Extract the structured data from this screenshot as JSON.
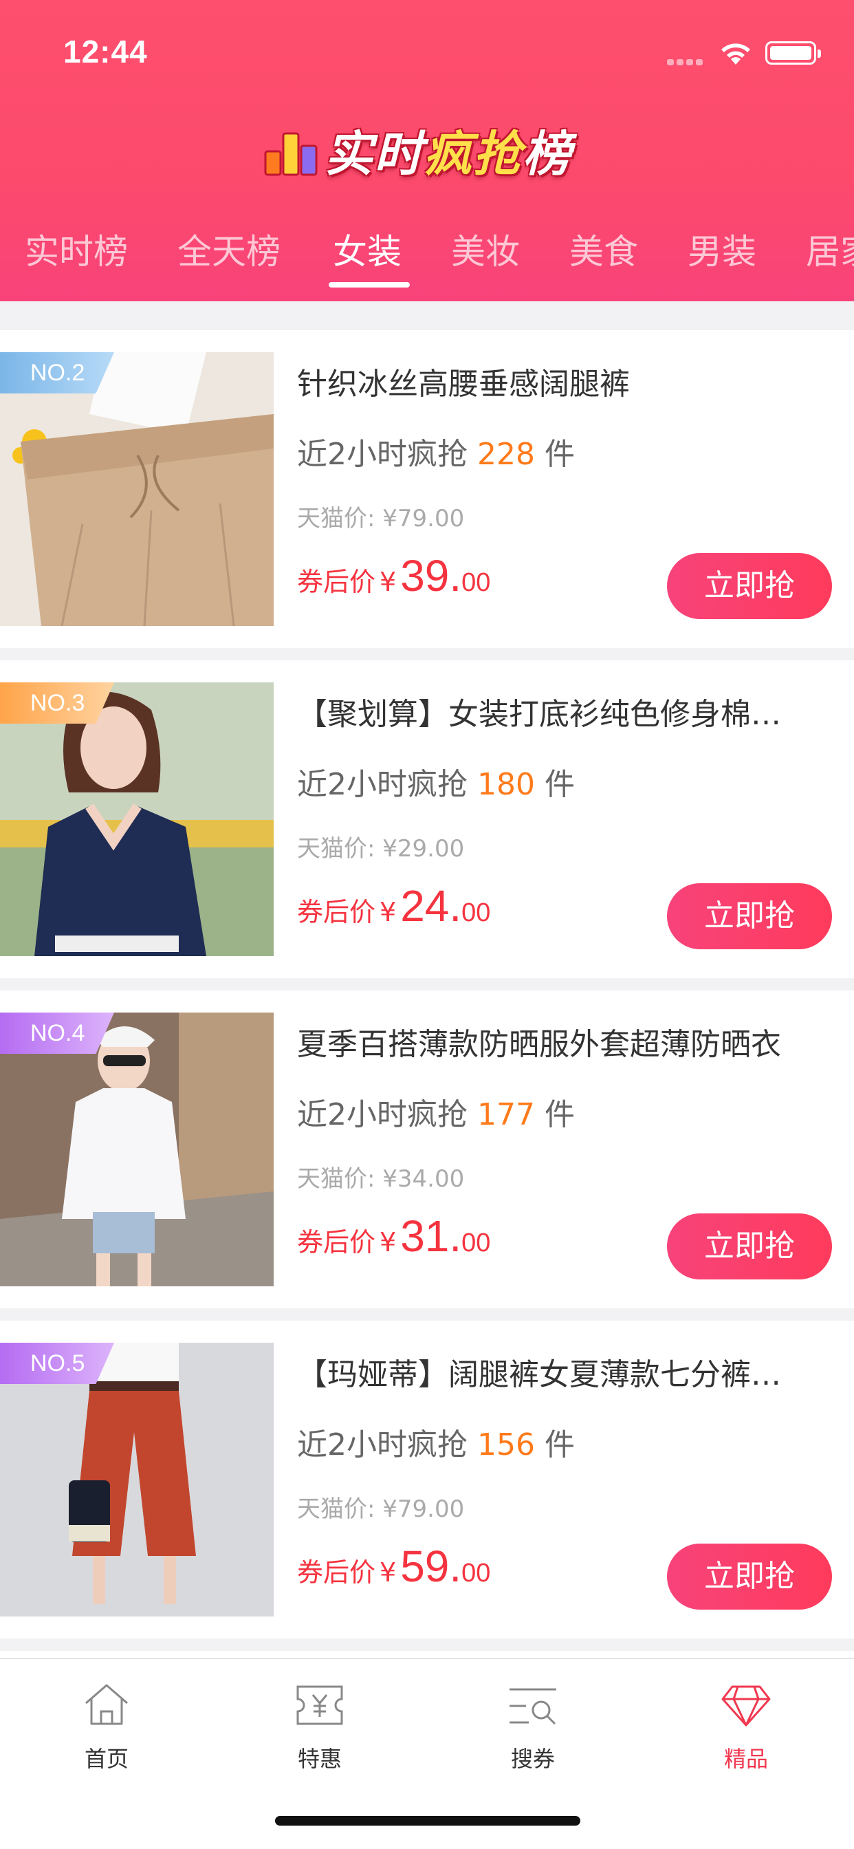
{
  "status_bar": {
    "time": "12:44"
  },
  "header": {
    "logo_text_1": "实时",
    "logo_text_2": "疯抢",
    "logo_text_3": "榜"
  },
  "tabs": [
    {
      "label": "实时榜"
    },
    {
      "label": "全天榜"
    },
    {
      "label": "女装",
      "active": true
    },
    {
      "label": "美妆"
    },
    {
      "label": "美食"
    },
    {
      "label": "男装"
    },
    {
      "label": "居家"
    }
  ],
  "items": [
    {
      "rank": "NO.2",
      "rank_color": "#8fc4ee",
      "title": "针织冰丝高腰垂感阔腿裤",
      "sales_prefix": "近2小时疯抢",
      "sales_count": "228",
      "sales_unit": "件",
      "original_price": "天猫价: ¥79.00",
      "after_label": "券后价",
      "currency": "¥",
      "price_int": "39.",
      "price_dec": "00",
      "buy_label": "立即抢"
    },
    {
      "rank": "NO.3",
      "rank_color": "#ffb36b",
      "title": "【聚划算】女装打底衫纯色修身棉…",
      "sales_prefix": "近2小时疯抢",
      "sales_count": "180",
      "sales_unit": "件",
      "original_price": "天猫价: ¥29.00",
      "after_label": "券后价",
      "currency": "¥",
      "price_int": "24.",
      "price_dec": "00",
      "buy_label": "立即抢"
    },
    {
      "rank": "NO.4",
      "rank_color": "#c07cf5",
      "title": "夏季百搭薄款防晒服外套超薄防晒衣",
      "sales_prefix": "近2小时疯抢",
      "sales_count": "177",
      "sales_unit": "件",
      "original_price": "天猫价: ¥34.00",
      "after_label": "券后价",
      "currency": "¥",
      "price_int": "31.",
      "price_dec": "00",
      "buy_label": "立即抢"
    },
    {
      "rank": "NO.5",
      "rank_color": "#c07cf5",
      "title": "【玛娅蒂】阔腿裤女夏薄款七分裤…",
      "sales_prefix": "近2小时疯抢",
      "sales_count": "156",
      "sales_unit": "件",
      "original_price": "天猫价: ¥79.00",
      "after_label": "券后价",
      "currency": "¥",
      "price_int": "59.",
      "price_dec": "00",
      "buy_label": "立即抢"
    }
  ],
  "tabbar": [
    {
      "label": "首页",
      "icon": "home-icon"
    },
    {
      "label": "特惠",
      "icon": "coupon-icon"
    },
    {
      "label": "搜券",
      "icon": "search-coupon-icon"
    },
    {
      "label": "精品",
      "icon": "diamond-icon",
      "active": true
    }
  ],
  "colors": {
    "brand": "#fb4a6c",
    "price_red": "#f5333f",
    "sales_orange": "#ff7a1a",
    "active_tab": "#f0384f"
  }
}
